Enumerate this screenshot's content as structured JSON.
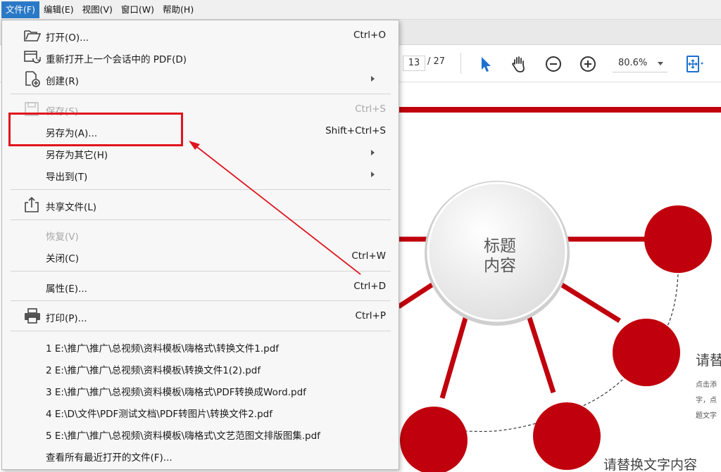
{
  "menubar": {
    "items": [
      {
        "label": "文件(F)",
        "active": true
      },
      {
        "label": "编辑(E)",
        "active": false
      },
      {
        "label": "视图(V)",
        "active": false
      },
      {
        "label": "窗口(W)",
        "active": false
      },
      {
        "label": "帮助(H)",
        "active": false
      }
    ]
  },
  "toolbar": {
    "page_current": "13",
    "page_total": "/ 27",
    "zoom": "80.6%"
  },
  "file_menu": {
    "open": {
      "label": "打开(O)...",
      "shortcut": "Ctrl+O"
    },
    "reopen": {
      "label": "重新打开上一个会话中的 PDF(D)"
    },
    "create": {
      "label": "创建(R)"
    },
    "save": {
      "label": "保存(S)",
      "shortcut": "Ctrl+S"
    },
    "save_as": {
      "label": "另存为(A)...",
      "shortcut": "Shift+Ctrl+S"
    },
    "save_as_other": {
      "label": "另存为其它(H)"
    },
    "export_to": {
      "label": "导出到(T)"
    },
    "share": {
      "label": "共享文件(L)"
    },
    "revert": {
      "label": "恢复(V)"
    },
    "close": {
      "label": "关闭(C)",
      "shortcut": "Ctrl+W"
    },
    "properties": {
      "label": "属性(E)...",
      "shortcut": "Ctrl+D"
    },
    "print": {
      "label": "打印(P)...",
      "shortcut": "Ctrl+P"
    },
    "recent": [
      "1 E:\\推广\\推广\\总视频\\资料模板\\嗨格式\\转换文件1.pdf",
      "2 E:\\推广\\推广\\总视频\\资料模板\\转换文件1(2).pdf",
      "3 E:\\推广\\推广\\总视频\\资料模板\\嗨格式\\PDF转换成Word.pdf",
      "4 E:\\D\\文件\\PDF测试文档\\PDF转图片\\转换文件2.pdf",
      "5 E:\\推广\\推广\\总视频\\资料模板\\嗨格式\\文艺范图文排版图集.pdf"
    ],
    "view_all_recent": "查看所有最近打开的文件(F)..."
  },
  "document": {
    "center_title_line1": "标题",
    "center_title_line2": "内容",
    "right_heading": "请替",
    "right_small_1": "点击添",
    "right_small_2": "字，点",
    "right_small_3": "题文字",
    "bottom_caption": "请替换文字内容"
  },
  "colors": {
    "accent_red": "#c0000c",
    "highlight_red": "#e0141e",
    "menu_active_blue": "#2a79c7",
    "toolbar_icon_blue": "#1c6fd1"
  }
}
